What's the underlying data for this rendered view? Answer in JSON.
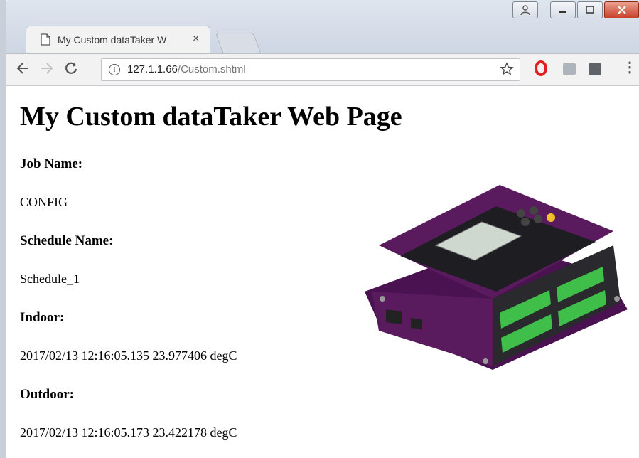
{
  "browser": {
    "tab_title": "My Custom dataTaker W",
    "tab_close": "×",
    "url_host": "127.1.1.66",
    "url_path": "/Custom.shtml",
    "icons": [
      "page-icon",
      "back-icon",
      "forward-icon",
      "reload-icon",
      "info-icon",
      "star-icon",
      "opera-icon",
      "chat-icon",
      "extension-icon",
      "menu-icon",
      "profile-icon",
      "minimize-icon",
      "maximize-icon",
      "close-icon"
    ]
  },
  "page": {
    "title": "My Custom dataTaker Web Page",
    "fields": [
      {
        "label": "Job Name:",
        "value": "CONFIG"
      },
      {
        "label": "Schedule Name:",
        "value": "Schedule_1"
      },
      {
        "label": "Indoor:",
        "value": "2017/02/13 12:16:05.135 23.977406 degC"
      },
      {
        "label": "Outdoor:",
        "value": "2017/02/13 12:16:05.173 23.422178 degC"
      }
    ]
  },
  "colors": {
    "device_body": "#5a1a5e",
    "terminal_green": "#3fbf4a",
    "close_button": "#c9402a"
  }
}
